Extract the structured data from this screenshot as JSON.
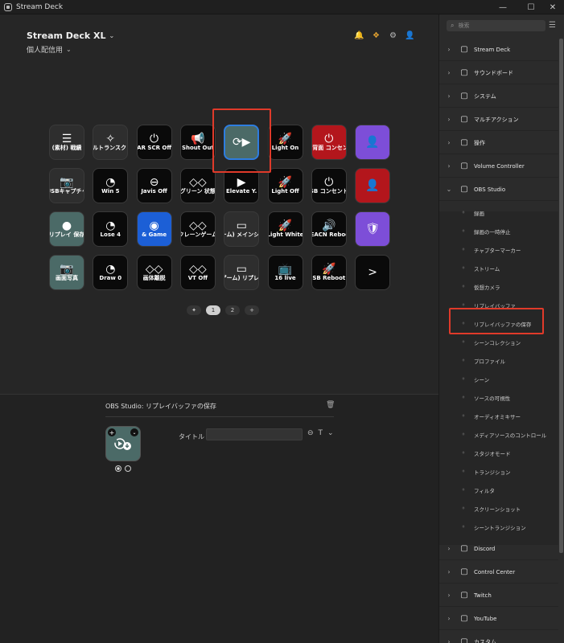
{
  "window": {
    "title": "Stream Deck",
    "minimize": "—",
    "maximize": "☐",
    "close": "✕"
  },
  "deck": {
    "name": "Stream Deck XL",
    "profile": "個人配信用"
  },
  "keys": [
    {
      "label": "(素材) 戦績",
      "glyph": "☰",
      "style": "gray"
    },
    {
      "label": "ーカルトランスク 英語",
      "glyph": "✧",
      "style": "gray"
    },
    {
      "label": "AR SCR Off",
      "glyph": "⏻",
      "style": "black"
    },
    {
      "label": "Shout Out",
      "glyph": "📢",
      "style": "black"
    },
    {
      "label": "",
      "glyph": "⟳▶",
      "style": "teal-selected"
    },
    {
      "label": "Light On",
      "glyph": "🚀",
      "style": "black"
    },
    {
      "label": "SB背面 コンセント",
      "glyph": "⏻",
      "style": "red"
    },
    {
      "label": "",
      "glyph": "👤",
      "style": "purple"
    },
    {
      "label": "USBキャプチャ",
      "glyph": "📷",
      "style": "gray"
    },
    {
      "label": "Win 5",
      "glyph": "◔",
      "style": "black"
    },
    {
      "label": "Javis Off",
      "glyph": "⊖",
      "style": "black"
    },
    {
      "label": "グリーン 状態",
      "glyph": "◇◇",
      "style": "black"
    },
    {
      "label": "Elevate Y.",
      "glyph": "▶",
      "style": "black"
    },
    {
      "label": "Light Off",
      "glyph": "🚀",
      "style": "black"
    },
    {
      "label": "SB コンセント",
      "glyph": "⏻",
      "style": "black"
    },
    {
      "label": "",
      "glyph": "👤",
      "style": "red"
    },
    {
      "label": "リプレイ 保存",
      "glyph": "●",
      "style": "teal"
    },
    {
      "label": "Lose 4",
      "glyph": "◔",
      "style": "black"
    },
    {
      "label": "& Game",
      "glyph": "◉",
      "style": "blue"
    },
    {
      "label": "クレーンゲーム",
      "glyph": "◇◇",
      "style": "black"
    },
    {
      "label": "(ゲーム) メインシーン",
      "glyph": "▭",
      "style": "gray"
    },
    {
      "label": "Light White",
      "glyph": "🚀",
      "style": "black"
    },
    {
      "label": "BEACN Reboot",
      "glyph": "🔊",
      "style": "black"
    },
    {
      "label": "",
      "glyph": "🛡",
      "style": "purple"
    },
    {
      "label": "画面写真",
      "glyph": "📷",
      "style": "teal"
    },
    {
      "label": "Draw 0",
      "glyph": "◔",
      "style": "black"
    },
    {
      "label": "画体離脱",
      "glyph": "◇◇",
      "style": "black"
    },
    {
      "label": "VT Off",
      "glyph": "◇◇",
      "style": "black"
    },
    {
      "label": "(ゲーム) リプレイ",
      "glyph": "▭",
      "style": "gray"
    },
    {
      "label": "16 live",
      "glyph": "📺",
      "style": "black"
    },
    {
      "label": "SB Reboot",
      "glyph": "🚀",
      "style": "black"
    },
    {
      "label": "",
      "glyph": ">",
      "style": "black"
    }
  ],
  "pager": {
    "pages": [
      "1",
      "2"
    ],
    "add": "+",
    "pin": "✦"
  },
  "config": {
    "title": "OBS Studio:  リプレイバッファの保存",
    "title_field_label": "タイトル :",
    "title_value": "",
    "font_toggle": "T"
  },
  "sidebar": {
    "search_placeholder": "検索",
    "categories_top": [
      {
        "label": "Stream Deck",
        "icon": "grid-icon"
      },
      {
        "label": "サウンドボード",
        "icon": "speaker-icon"
      },
      {
        "label": "システム",
        "icon": "pc-icon"
      },
      {
        "label": "マルチアクション",
        "icon": "multi-icon"
      },
      {
        "label": "操作",
        "icon": "navigate-icon"
      },
      {
        "label": "Volume Controller",
        "icon": "volume-icon"
      },
      {
        "label": "OBS Studio",
        "icon": "obs-icon"
      }
    ],
    "obs_actions": [
      "録画",
      "録画の一時停止",
      "チャプターマーカー",
      "ストリーム",
      "仮想カメラ",
      "リプレイバッファ",
      "リプレイバッファの保存",
      "シーンコレクション",
      "プロファイル",
      "シーン",
      "ソースの可視性",
      "オーディオミキサー",
      "メディアソースのコントロール",
      "スタジオモード",
      "トランジション",
      "フィルタ",
      "スクリーンショット",
      "シーントランジション"
    ],
    "categories_bottom": [
      {
        "label": "Discord",
        "icon": "discord-icon"
      },
      {
        "label": "Control Center",
        "icon": "sliders-icon"
      },
      {
        "label": "Twitch",
        "icon": "twitch-icon"
      },
      {
        "label": "YouTube",
        "icon": "youtube-icon"
      },
      {
        "label": "カスタム",
        "icon": "custom-icon"
      }
    ]
  },
  "colors": {
    "highlight": "#e03a2a",
    "selected_key": "#2d7de0",
    "accent_teal": "#4b6a67"
  }
}
